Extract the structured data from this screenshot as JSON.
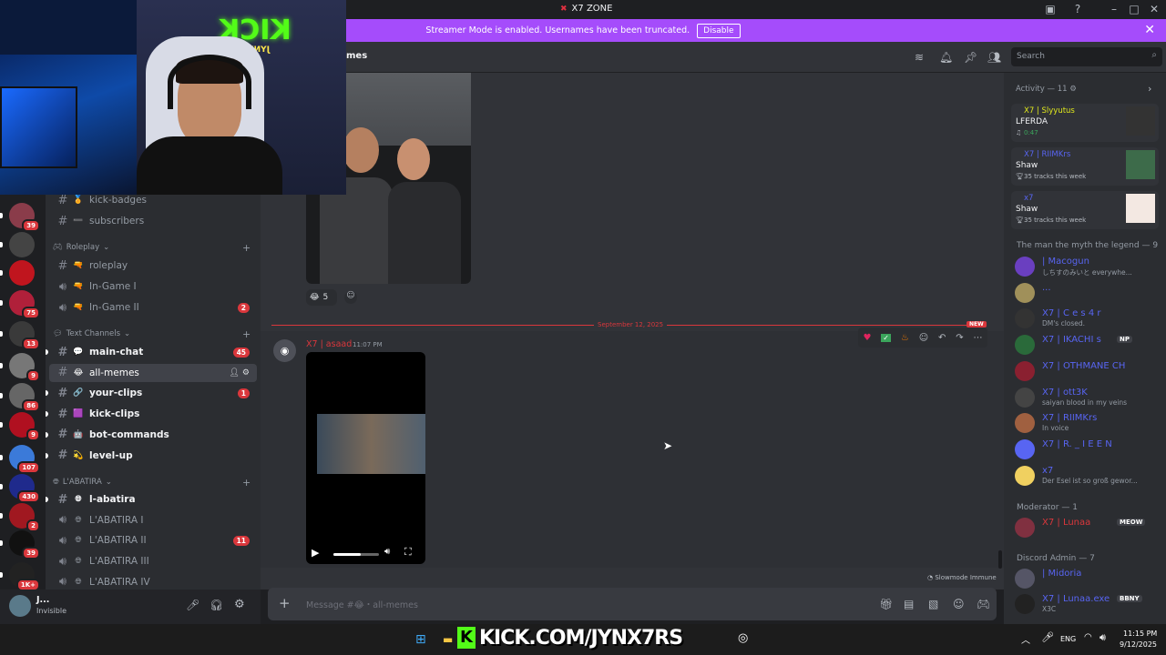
{
  "window": {
    "title": "X7 ZONE"
  },
  "banner": {
    "text": "Streamer Mode is enabled. Usernames have been truncated.",
    "button": "Disable"
  },
  "overlay": {
    "kick_sign": "KICK",
    "kick_sub": "JYNX7RS",
    "kick_url": "KICK.COM/JYNX7RS"
  },
  "servers": [
    {
      "badge": "39",
      "color": "#8a3c4a"
    },
    {
      "badge": "",
      "color": "#444"
    },
    {
      "badge": "",
      "color": "#c0151e"
    },
    {
      "badge": "75",
      "color": "#b0203a"
    },
    {
      "badge": "13",
      "color": "#3a3a3a"
    },
    {
      "badge": "9",
      "color": "#777"
    },
    {
      "badge": "86",
      "color": "#666"
    },
    {
      "badge": "9",
      "color": "#b01020"
    },
    {
      "badge": "107",
      "color": "#3b7ad9"
    },
    {
      "badge": "430",
      "color": "#1f2a8c"
    },
    {
      "badge": "2",
      "color": "#a01820"
    },
    {
      "badge": "39",
      "color": "#111"
    },
    {
      "badge": "1K+",
      "color": "#222"
    }
  ],
  "channels": {
    "top": [
      {
        "label": "kick-badges",
        "emoji": "🏅"
      },
      {
        "label": "subscribers",
        "emoji": "➖"
      }
    ],
    "roleplay": {
      "title": "Roleplay",
      "items": [
        {
          "label": "roleplay",
          "icon": "#",
          "emoji": "🔫",
          "count": ""
        },
        {
          "label": "In-Game I",
          "icon": "🔊",
          "emoji": "🔫",
          "count": ""
        },
        {
          "label": "In-Game II",
          "icon": "🔊",
          "emoji": "🔫",
          "count": "2"
        }
      ]
    },
    "text": {
      "title": "Text Channels",
      "items": [
        {
          "label": "main-chat",
          "emoji": "💬",
          "count": "45",
          "unread": true
        },
        {
          "label": "all-memes",
          "emoji": "😂",
          "count": "",
          "active": true
        },
        {
          "label": "your-clips",
          "emoji": "🔗",
          "count": "1",
          "unread": true
        },
        {
          "label": "kick-clips",
          "emoji": "🟪",
          "count": "",
          "unread": true
        },
        {
          "label": "bot-commands",
          "emoji": "🤖",
          "count": "",
          "unread": true
        },
        {
          "label": "level-up",
          "emoji": "💫",
          "count": "",
          "unread": true
        }
      ]
    },
    "labatira": {
      "title": "L'ABATIRA",
      "items": [
        {
          "label": "l-abatira",
          "icon": "#",
          "count": "",
          "unread": true
        },
        {
          "label": "L'ABATIRA I",
          "icon": "🔊",
          "count": ""
        },
        {
          "label": "L'ABATIRA II",
          "icon": "🔊",
          "count": "11"
        },
        {
          "label": "L'ABATIRA III",
          "icon": "🔊",
          "count": ""
        },
        {
          "label": "L'ABATIRA IV",
          "icon": "🔊",
          "count": ""
        }
      ]
    }
  },
  "user": {
    "name": "J...",
    "status": "Invisible"
  },
  "chat": {
    "channel_name": "all-memes",
    "header_fragment": "mes",
    "reaction_count": "5",
    "date_divider": "September 12, 2025",
    "new_label": "NEW",
    "message_author": "X7 | asaad",
    "message_time": "11:07 PM",
    "slowmode": "Slowmode Immune",
    "composer_placeholder": "Message #😂・all-memes"
  },
  "search": {
    "placeholder": "Search"
  },
  "members": {
    "activity_title": "Activity — 11",
    "activities": [
      {
        "user": "X7 | Slyyutus",
        "title": "LFERDA",
        "sub": "0:47",
        "color": "#e0e81c"
      },
      {
        "user": "X7 | RIIMKrs",
        "title": "Shaw",
        "sub": "35 tracks this week",
        "color": "#5865f2"
      },
      {
        "user": "x7",
        "title": "Shaw",
        "sub": "35 tracks this week",
        "color": "#5865f2"
      }
    ],
    "group1": "The man the myth the legend — 9",
    "group1_members": [
      {
        "name": "| Macogun",
        "status": "しちすのみいと everywhe...",
        "color": "#5865f2"
      },
      {
        "name": "...",
        "status": "",
        "color": "#5865f2"
      },
      {
        "name": "X7 | C e s 4 r",
        "status": "DM's closed.",
        "color": "#5865f2"
      },
      {
        "name": "X7 | IKACHI s",
        "status": "",
        "color": "#5865f2",
        "tag": "NP"
      },
      {
        "name": "X7 | OTHMANE CH",
        "status": "",
        "color": "#5865f2"
      },
      {
        "name": "X7 | ott3K",
        "status": "saiyan blood in my veins",
        "color": "#5865f2"
      },
      {
        "name": "X7 | RIIMKrs",
        "status": "In voice",
        "color": "#5865f2"
      },
      {
        "name": "X7 | R. _ I E E N",
        "status": "",
        "color": "#5865f2"
      },
      {
        "name": "x7",
        "status": "Der Esel ist so groß gewor...",
        "color": "#5865f2"
      }
    ],
    "group2": "Moderator — 1",
    "group2_members": [
      {
        "name": "X7 | Lunaa",
        "status": "",
        "color": "#da373c",
        "tag": "MEOW"
      }
    ],
    "group3": "Discord Admin — 7",
    "group3_members": [
      {
        "name": "| Midoria",
        "status": "",
        "color": "#5865f2"
      },
      {
        "name": "X7 | Lunaa.exe",
        "status": "X3C",
        "color": "#5865f2",
        "tag": "BBNY"
      }
    ]
  },
  "taskbar": {
    "lang": "ENG",
    "time": "11:15 PM",
    "date": "9/12/2025"
  }
}
